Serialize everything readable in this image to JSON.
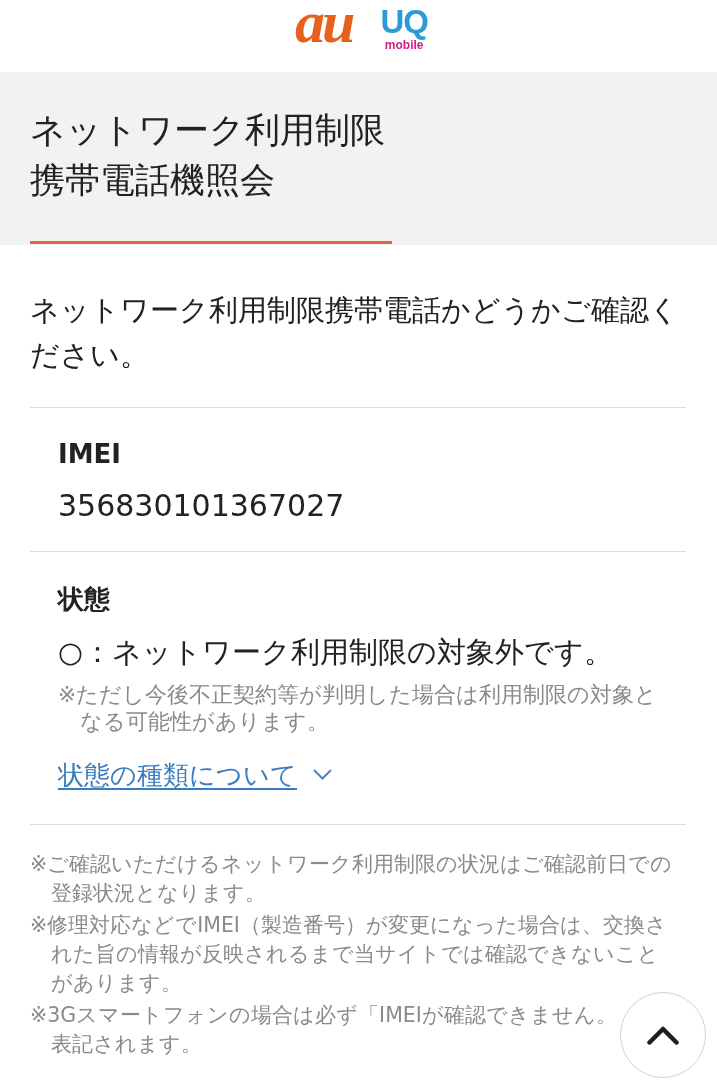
{
  "header": {
    "logos": [
      {
        "kind": "au",
        "text": "au"
      },
      {
        "kind": "uq",
        "text": "UQ",
        "tagline": "mobile"
      }
    ]
  },
  "title_lines": [
    "ネットワーク利用制限",
    "携帯電話機照会"
  ],
  "intro": "ネットワーク利用制限携帯電話かどうかご確認ください。",
  "imei": {
    "label": "IMEI",
    "value": "356830101367027"
  },
  "status": {
    "label": "状態",
    "value": "○：ネットワーク利用制限の対象外です。",
    "note": "※ただし今後不正契約等が判明した場合は利用制限の対象となる可能性があります。",
    "link": {
      "text": "状態の種類について",
      "expanded": false
    }
  },
  "footnotes": [
    "※ご確認いただけるネットワーク利用制限の状況はご確認前日での登録状況となります。",
    "※修理対応などでIMEI（製造番号）が変更になった場合は、交換された旨の情報が反映されるまで当サイトでは確認できないことがあります。",
    "※3Gスマートフォンの場合は必ず「IMEIが確認できません。表記されます。"
  ]
}
